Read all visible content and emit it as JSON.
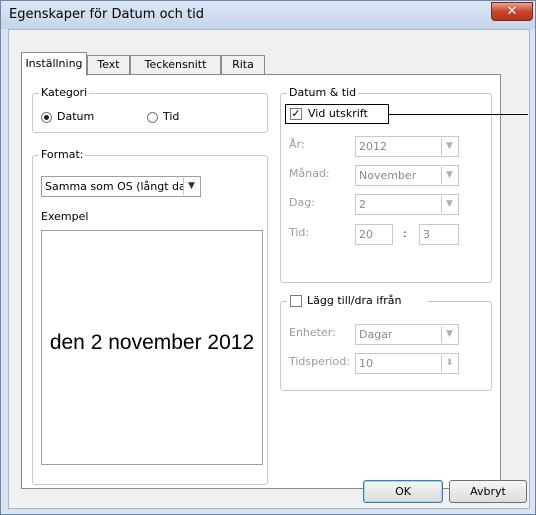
{
  "window": {
    "title": "Egenskaper för Datum och tid",
    "close_glyph": "✕"
  },
  "tabs": [
    {
      "label": "Inställning",
      "active": true
    },
    {
      "label": "Text",
      "active": false
    },
    {
      "label": "Teckensnitt",
      "active": false
    },
    {
      "label": "Rita",
      "active": false
    }
  ],
  "kategori": {
    "legend": "Kategori",
    "options": [
      {
        "label": "Datum",
        "checked": true
      },
      {
        "label": "Tid",
        "checked": false
      }
    ]
  },
  "format": {
    "legend": "Format:",
    "selected": "Samma som OS (långt da",
    "example_label": "Exempel",
    "example_text": "den 2 november 2012"
  },
  "datum_tid": {
    "legend": "Datum & tid",
    "print_checkbox": {
      "label": "Vid utskrift",
      "checked": true,
      "mark": "✓"
    },
    "fields": {
      "year": {
        "label": "År:",
        "value": "2012"
      },
      "month": {
        "label": "Månad:",
        "value": "November"
      },
      "day": {
        "label": "Dag:",
        "value": "2"
      },
      "time": {
        "label": "Tid:",
        "hour": "20",
        "separator": ":",
        "minute": "3"
      }
    }
  },
  "add_subtract": {
    "legend": "Lägg till/dra ifrån",
    "checked": false,
    "unit": {
      "label": "Enheter:",
      "value": "Dagar"
    },
    "period": {
      "label": "Tidsperiod:",
      "value": "10"
    }
  },
  "buttons": {
    "ok": "OK",
    "cancel": "Avbryt"
  },
  "icons": {
    "dropdown": "▼",
    "spin": "⬍"
  },
  "colors": {
    "title_bg": "#c4d5ea",
    "close_bg": "#c7442a",
    "disabled_text": "#9a9a9a"
  }
}
